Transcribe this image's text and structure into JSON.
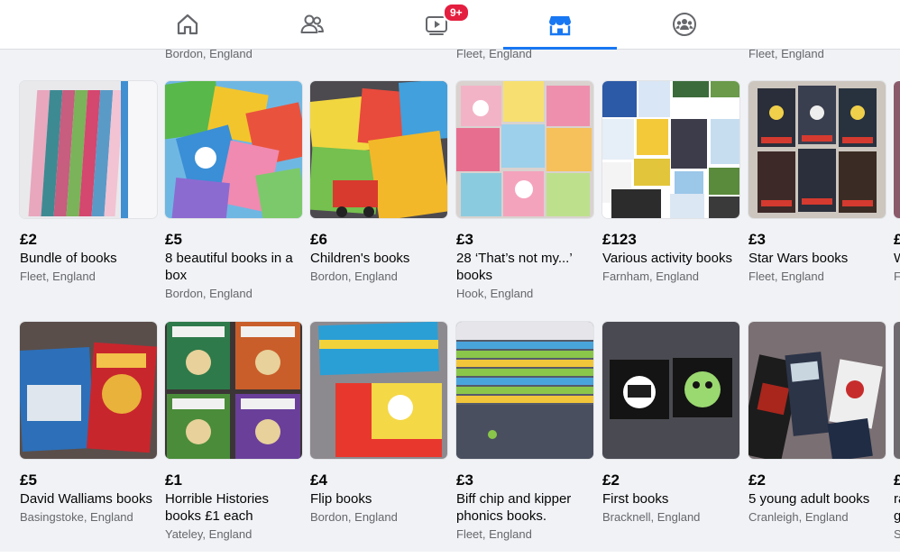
{
  "nav": {
    "tabs": [
      {
        "name": "home",
        "icon": "home-icon"
      },
      {
        "name": "friends",
        "icon": "friends-icon"
      },
      {
        "name": "watch",
        "icon": "video-icon",
        "badge": "9+"
      },
      {
        "name": "marketplace",
        "icon": "marketplace-icon",
        "active": true
      },
      {
        "name": "groups",
        "icon": "groups-icon"
      }
    ],
    "accent": "#1877f2"
  },
  "previous_row_locations": [
    "Bordon, England",
    "Fleet, England",
    "Fleet, England"
  ],
  "listings_row1": [
    {
      "price": "£2",
      "title": "Bundle of books",
      "location": "Fleet, England"
    },
    {
      "price": "£5",
      "title": "8 beautiful books in a box",
      "location": "Bordon, England"
    },
    {
      "price": "£6",
      "title": "Children's books",
      "location": "Bordon, England"
    },
    {
      "price": "£3",
      "title": "28 ‘That’s not my...’ books",
      "location": "Hook, England"
    },
    {
      "price": "£123",
      "title": "Various activity books",
      "location": "Farnham, England"
    },
    {
      "price": "£3",
      "title": "Star Wars books",
      "location": "Fleet, England"
    },
    {
      "price": "£",
      "title": "W",
      "location": "F"
    }
  ],
  "listings_row2": [
    {
      "price": "£5",
      "title": "David Walliams books",
      "location": "Basingstoke, England"
    },
    {
      "price": "£1",
      "title": "Horrible Histories books £1 each",
      "location": "Yateley, England"
    },
    {
      "price": "£4",
      "title": "Flip books",
      "location": "Bordon, England"
    },
    {
      "price": "£3",
      "title": "Biff chip and kipper phonics books.",
      "location": "Fleet, England"
    },
    {
      "price": "£2",
      "title": "First books",
      "location": "Bracknell, England"
    },
    {
      "price": "£2",
      "title": "5 young adult books",
      "location": "Cranleigh, England"
    },
    {
      "price": "£",
      "title": "ra g",
      "location": "S"
    }
  ]
}
